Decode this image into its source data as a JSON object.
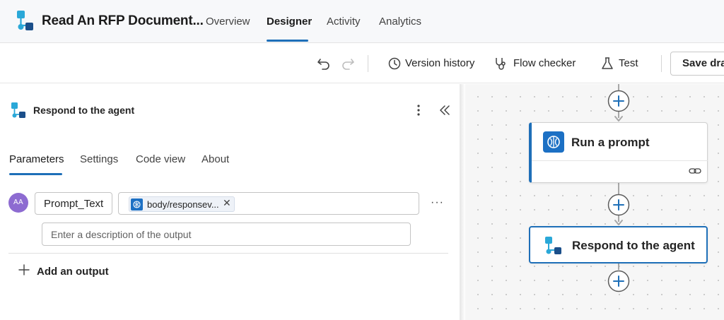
{
  "header": {
    "title": "Read An RFP Document...",
    "tabs": [
      {
        "label": "Overview"
      },
      {
        "label": "Designer"
      },
      {
        "label": "Activity"
      },
      {
        "label": "Analytics"
      }
    ],
    "active_tab": "Designer"
  },
  "toolbar": {
    "undo_icon": "undo-icon",
    "redo_icon": "redo-icon",
    "version_history": "Version history",
    "flow_checker": "Flow checker",
    "test": "Test",
    "save_draft": "Save draft"
  },
  "panel": {
    "title": "Respond to the agent",
    "tabs": [
      {
        "label": "Parameters"
      },
      {
        "label": "Settings"
      },
      {
        "label": "Code view"
      },
      {
        "label": "About"
      }
    ],
    "active_tab": "Parameters",
    "output": {
      "avatar_text": "AA",
      "name": "Prompt_Text",
      "token_label": "body/responsev...",
      "token_close": "✕",
      "more": "···",
      "description_placeholder": "Enter a description of the output"
    },
    "add_output": "Add an output"
  },
  "canvas": {
    "nodes": [
      {
        "title": "Run a prompt",
        "icon": "ai-prompt-icon"
      },
      {
        "title": "Respond to the agent",
        "icon": "agent-flow-icon"
      }
    ]
  },
  "colors": {
    "accent": "#1e6fb8",
    "avatar": "#8d6bd1",
    "prompt_icon_bg": "#1c70c4"
  }
}
